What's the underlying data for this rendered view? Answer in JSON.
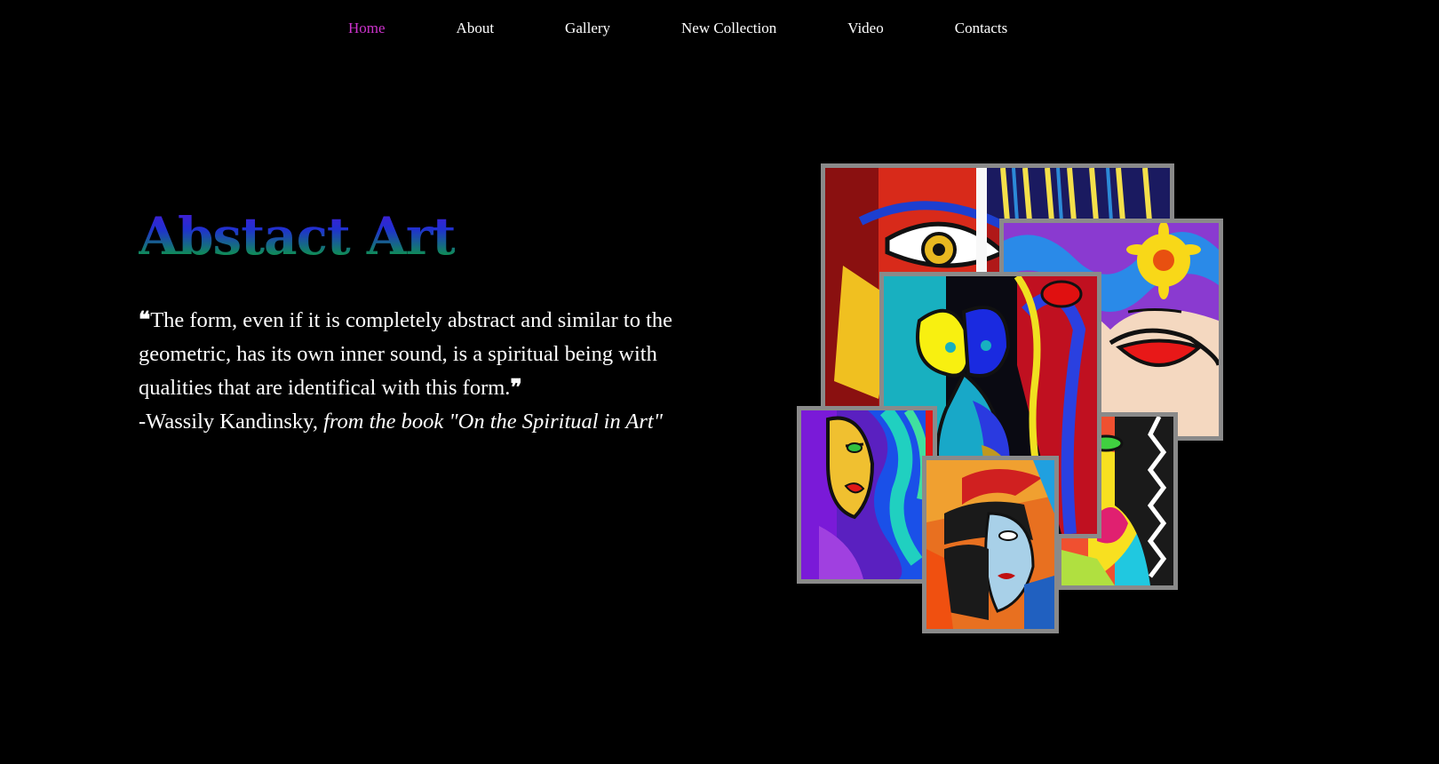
{
  "nav": {
    "items": [
      {
        "label": "Home",
        "active": true
      },
      {
        "label": "About",
        "active": false
      },
      {
        "label": "Gallery",
        "active": false
      },
      {
        "label": "New Collection",
        "active": false
      },
      {
        "label": "Video",
        "active": false
      },
      {
        "label": "Contacts",
        "active": false
      }
    ],
    "active_color": "#cc33cc",
    "text_color": "#ffffff"
  },
  "hero": {
    "title": "Abstact Art",
    "title_gradient": [
      "#5a10d8",
      "#2030d0",
      "#108a5a",
      "#07c448"
    ],
    "quote_open": "❝",
    "quote_text": "The form, even if it is completely abstract and similar to the geometric, has its own inner sound, is a spiritual being with qualities that are identifical with this form.",
    "quote_close": "❞",
    "attribution_author": "-Wassily Kandinsky, ",
    "attribution_source": "from the book \"On the Spiritual in Art\""
  },
  "gallery": {
    "frame_color": "#8a8a8a",
    "paintings": [
      {
        "name": "painting-eye-face"
      },
      {
        "name": "painting-flower-lips-face"
      },
      {
        "name": "painting-cat"
      },
      {
        "name": "painting-profile-faces"
      },
      {
        "name": "painting-blue-hair-woman"
      },
      {
        "name": "painting-hat-face"
      }
    ]
  }
}
